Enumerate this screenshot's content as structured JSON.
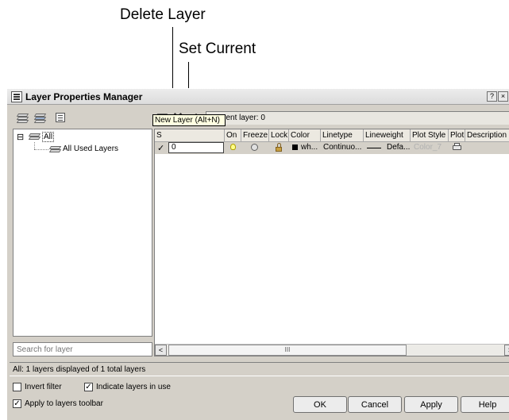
{
  "callouts": {
    "delete_layer": "Delete Layer",
    "set_current": "Set Current"
  },
  "window": {
    "title": "Layer Properties Manager",
    "help_button": "?",
    "close_button": "×"
  },
  "toolbar": {
    "current_layer": "Current layer: 0",
    "delete_glyph": "✕",
    "set_current_glyph": "✓"
  },
  "tooltip": "New Layer (Alt+N)",
  "tree": {
    "root_label": "All",
    "child_label": "All Used Layers",
    "expander": "⊟"
  },
  "search": {
    "placeholder": "Search for layer"
  },
  "grid": {
    "columns": [
      "S",
      "On",
      "Freeze",
      "Lock",
      "Color",
      "Linetype",
      "Lineweight",
      "Plot Style",
      "Plot",
      "Description"
    ],
    "row": {
      "status": "✓",
      "name": "0",
      "color": "wh...",
      "linetype": "Continuo...",
      "lineweight": "Defa...",
      "plot_style": "Color_7"
    },
    "scroll_grip": "III",
    "scroll_left": "<",
    "scroll_right": ">"
  },
  "status_text": "All: 1 layers displayed of 1 total layers",
  "options": {
    "invert_filter": "Invert filter",
    "indicate_in_use": "Indicate layers in use",
    "apply_toolbar": "Apply to layers toolbar",
    "invert_filter_checked": false,
    "indicate_in_use_checked": true,
    "apply_toolbar_checked": true,
    "check_glyph": "✓"
  },
  "buttons": {
    "ok": "OK",
    "cancel": "Cancel",
    "apply": "Apply",
    "help": "Help"
  },
  "colors": {
    "dialog_bg": "#d4d0c8",
    "tooltip_bg": "#ffffe1",
    "selected_row_bg": "#d4d0c8"
  }
}
